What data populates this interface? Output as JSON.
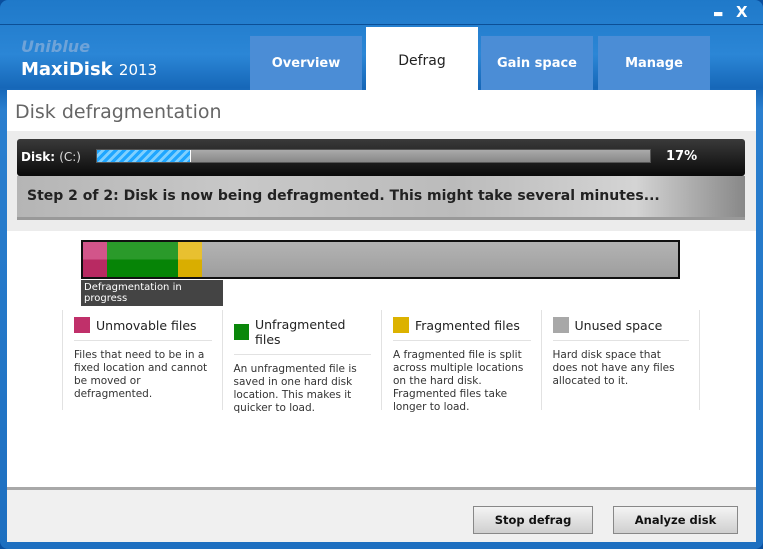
{
  "window": {
    "minimize": "▬",
    "close": "X"
  },
  "brand": {
    "company": "Uniblue",
    "product": "MaxiDisk",
    "year": "2013"
  },
  "tabs": [
    {
      "label": "Overview"
    },
    {
      "label": "Defrag"
    },
    {
      "label": "Gain space"
    },
    {
      "label": "Manage"
    }
  ],
  "page_title": "Disk defragmentation",
  "progress": {
    "disk_label": "Disk:",
    "disk_name": "(C:)",
    "percent": 17,
    "percent_text": "17%",
    "status": "Step 2 of 2: Disk is now being defragmented. This might take several minutes..."
  },
  "disk_map": {
    "label": "Defragmentation in progress",
    "segments": [
      {
        "type": "unmovable",
        "fraction": 0.04
      },
      {
        "type": "unfragmented",
        "fraction": 0.12
      },
      {
        "type": "fragmented",
        "fraction": 0.04
      },
      {
        "type": "unused",
        "fraction": 0.8
      }
    ]
  },
  "legend": [
    {
      "title": "Unmovable files",
      "color": "#c0306a",
      "desc": "Files that need to be in a fixed location and cannot be moved or defragmented."
    },
    {
      "title": "Unfragmented files",
      "color": "#0a870a",
      "desc": "An unfragmented file is saved in one hard disk location. This makes it quicker to load."
    },
    {
      "title": "Fragmented files",
      "color": "#dcb200",
      "desc": "A fragmented file is split across multiple locations on the hard disk. Fragmented files take longer to load."
    },
    {
      "title": "Unused space",
      "color": "#a8a8a8",
      "desc": "Hard disk space that does not have any files allocated to it."
    }
  ],
  "buttons": {
    "stop": "Stop defrag",
    "analyze": "Analyze disk"
  }
}
